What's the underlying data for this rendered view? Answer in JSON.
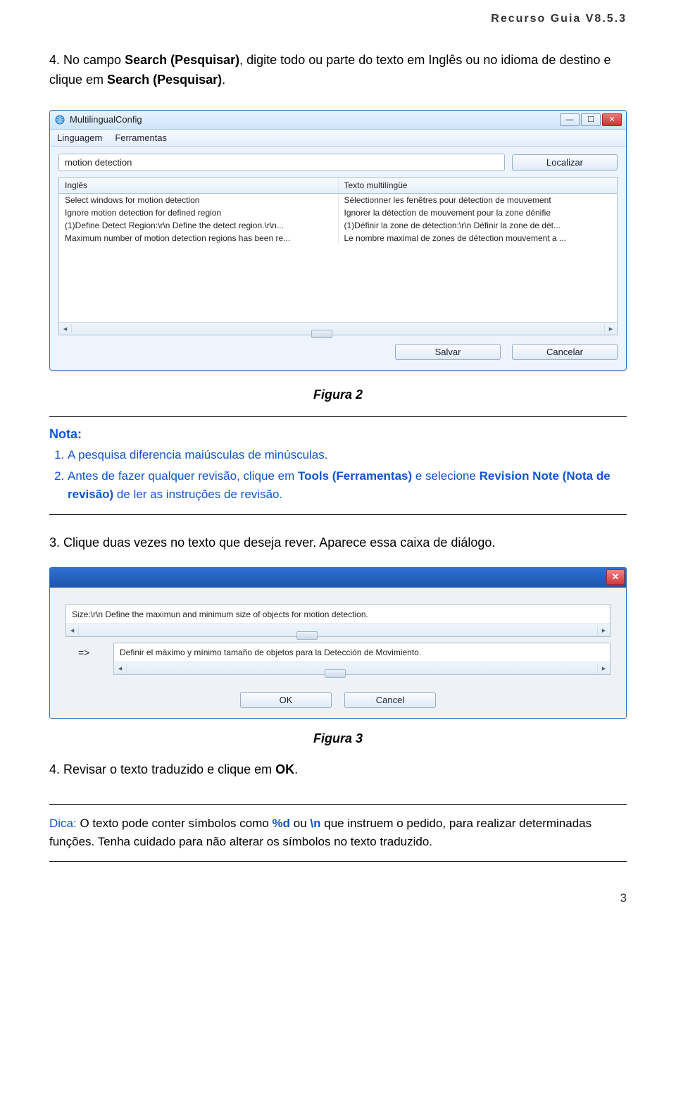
{
  "doc": {
    "header": "Recurso Guia V8.5.3",
    "step4": {
      "prefix": "4. No campo ",
      "b1": "Search (Pesquisar)",
      "mid": ", digite todo ou parte do texto em Inglês ou no idioma de destino e clique em ",
      "b2": "Search (Pesquisar)",
      "suffix": "."
    },
    "figure2": "Figura 2",
    "nota_head": "Nota:",
    "nota1": "A pesquisa diferencia maiúsculas de minúsculas.",
    "nota2": {
      "a": "Antes de fazer qualquer revisão, clique em ",
      "k1": "Tools (Ferramentas)",
      "b": " e selecione ",
      "k2": "Revision Note (Nota de revisão)",
      "c": " de ler as instruções de revisão."
    },
    "step3": "3. Clique duas vezes no texto que deseja rever. Aparece essa caixa de diálogo.",
    "figure3": "Figura 3",
    "step4b": {
      "a": "4. Revisar o texto traduzido e clique em ",
      "k": "OK",
      "b": "."
    },
    "tip": {
      "a": "Dica:",
      "b": " O texto pode conter símbolos como ",
      "s1": "%d",
      "c": " ou ",
      "s2": "\\n",
      "d": " que instruem o pedido, para realizar determinadas funções. Tenha cuidado para não alterar os símbolos no texto traduzido."
    },
    "page": "3"
  },
  "win1": {
    "title": "MultilingualConfig",
    "menu_lang": "Linguagem",
    "menu_tools": "Ferramentas",
    "search_value": "motion detection",
    "btn_search": "Localizar",
    "col1": "Inglês",
    "col2": "Texto multilíngüe",
    "rows": [
      {
        "en": "Select windows for motion detection",
        "ml": "Sélectionner les fenêtres pour détection de mouvement"
      },
      {
        "en": "Ignore motion detection for defined region",
        "ml": "Ignorer la détection de mouvement pour la zone dénifie"
      },
      {
        "en": "(1)Define Detect Region:\\r\\n Define the detect region.\\r\\n...",
        "ml": "(1)Définir la zone de détection:\\r\\n Définir la zone de dét..."
      },
      {
        "en": "Maximum number of motion detection regions has been re...",
        "ml": "Le nombre maximal de zones de détection mouvement a ..."
      }
    ],
    "btn_save": "Salvar",
    "btn_cancel": "Cancelar"
  },
  "win2": {
    "src": "Size:\\r\\n Define the maximun and minimum size of objects for motion detection.",
    "arrow": "=>",
    "dst": "Definir el máximo y mínimo tamaño de objetos para la Detección de Movimiento.",
    "ok": "OK",
    "cancel": "Cancel"
  }
}
